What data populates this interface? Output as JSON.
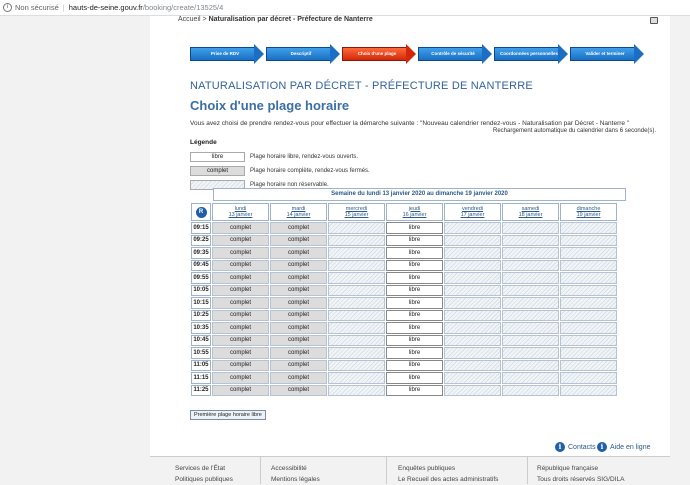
{
  "browser": {
    "security": "Non sécurisé",
    "host": "hauts-de-seine.gouv.fr",
    "path": "/booking/create/13525/4"
  },
  "breadcrumb": {
    "home": "Accueil",
    "sep": ">",
    "current": "Naturalisation par décret - Préfecture de Nanterre"
  },
  "steps": [
    {
      "label": "Prise de RDV",
      "active": false
    },
    {
      "label": "Descriptif",
      "active": false
    },
    {
      "label": "Choix d'une plage",
      "active": true
    },
    {
      "label": "Contrôle de sécurité",
      "active": false
    },
    {
      "label": "Coordonnées personnelles",
      "active": false
    },
    {
      "label": "Valider et terminer",
      "active": false
    }
  ],
  "agency_title": "NATURALISATION PAR DÉCRET - PRÉFECTURE DE NANTERRE",
  "page_title": "Choix d'une plage horaire",
  "intro": "Vous avez choisi de prendre rendez-vous pour effectuer la démarche suivante : \"Nouveau calendrier rendez-vous - Naturalisation par Décret - Nanterre \"",
  "reload": "Rechargement automatique du calendrier dans 6   seconde(s).",
  "legend": {
    "title": "Légende",
    "free_label": "libre",
    "free_desc": "Plage horaire libre, rendez-vous ouverts.",
    "full_label": "complet",
    "full_desc": "Plage horaire complète, rendez-vous fermés.",
    "na_desc": "Plage horaire non réservable."
  },
  "week_label": "Semaine du lundi 13 janvier 2020 au dimanche 19 janvier 2020",
  "days": [
    {
      "name": "lundi",
      "date": "13 janvier"
    },
    {
      "name": "mardi",
      "date": "14 janvier"
    },
    {
      "name": "mercredi",
      "date": "15 janvier"
    },
    {
      "name": "jeudi",
      "date": "16 janvier"
    },
    {
      "name": "vendredi",
      "date": "17 janvier"
    },
    {
      "name": "samedi",
      "date": "18 janvier"
    },
    {
      "name": "dimanche",
      "date": "19 janvier"
    }
  ],
  "slots": [
    "09:15",
    "09:25",
    "09:35",
    "09:45",
    "09:55",
    "10:05",
    "10:15",
    "10:25",
    "10:35",
    "10:45",
    "10:55",
    "11:05",
    "11:15",
    "11:25"
  ],
  "day_status": [
    "full",
    "full",
    "na",
    "free",
    "na",
    "na",
    "na"
  ],
  "status_text": {
    "free": "libre",
    "full": "complet",
    "na": ""
  },
  "first_button": "Première plage horaire libre",
  "help": {
    "contacts": "Contacts",
    "online": "Aide en ligne"
  },
  "footer": {
    "col1": [
      "Services de l'État",
      "Politiques publiques"
    ],
    "col2": [
      "Accessibilité",
      "Mentions légales"
    ],
    "col3": [
      "Enquêtes publiques",
      "Le Recueil des actes administratifs"
    ],
    "col4": [
      "République française",
      "Tous droits réservés SIG/DILA"
    ]
  }
}
